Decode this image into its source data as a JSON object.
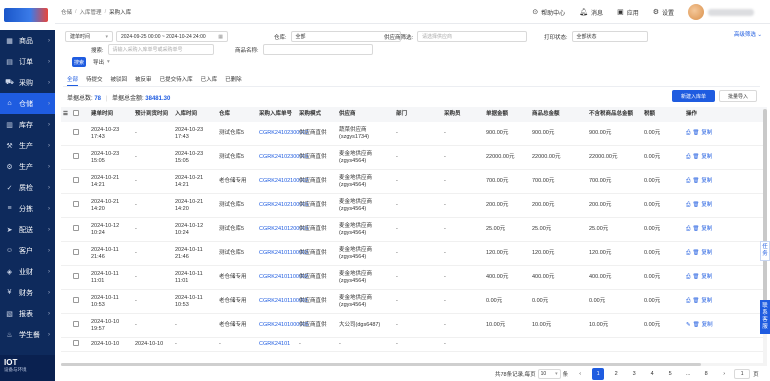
{
  "sidebar": {
    "items": [
      {
        "label": "商品",
        "icon": "grid-icon"
      },
      {
        "label": "订单",
        "icon": "order-icon"
      },
      {
        "label": "采购",
        "icon": "cart-icon"
      },
      {
        "label": "仓储",
        "icon": "warehouse-icon",
        "active": true
      },
      {
        "label": "库存",
        "icon": "stock-icon"
      },
      {
        "label": "生产",
        "icon": "production-icon"
      },
      {
        "label": "生产",
        "icon": "factory-icon"
      },
      {
        "label": "质检",
        "icon": "quality-icon"
      },
      {
        "label": "分拣",
        "icon": "sort-icon"
      },
      {
        "label": "配送",
        "icon": "delivery-icon"
      },
      {
        "label": "客户",
        "icon": "customer-icon"
      },
      {
        "label": "业财",
        "icon": "finance-icon"
      },
      {
        "label": "财务",
        "icon": "money-icon"
      },
      {
        "label": "报表",
        "icon": "report-icon"
      },
      {
        "label": "学生餐",
        "icon": "meal-icon"
      }
    ],
    "footer_title": "IOT",
    "footer_sub": "设备与环境"
  },
  "breadcrumb": [
    "仓储",
    "入库管理",
    "采购入库"
  ],
  "top": {
    "help": "帮助中心",
    "messages": "消息",
    "apps": "应用",
    "settings": "设置"
  },
  "filters": {
    "date_type": "建单时间",
    "date_range": "2024-09-25 00:00 ~ 2024-10-24 24:00",
    "warehouse_label": "仓库:",
    "warehouse_value": "全部",
    "supplier_label": "供应商筛选:",
    "supplier_placeholder": "请选择供应商",
    "print_label": "打印状态:",
    "print_value": "全部状态",
    "advanced": "高级筛选",
    "search_label": "搜索:",
    "search_placeholder": "请输入采购入库单号或采购单号",
    "product_label": "商品名称:",
    "search_button": "搜索",
    "export_button": "导出"
  },
  "tabs": [
    "全部",
    "待提交",
    "被驳回",
    "被反审",
    "已提交待入库",
    "已入库",
    "已删除"
  ],
  "summary": {
    "count_label": "单据总数:",
    "count": "78",
    "amount_label": "单据总金额:",
    "amount": "38481.30"
  },
  "actions": {
    "new": "新建入库单",
    "batch": "批量导入"
  },
  "table": {
    "headers": [
      "建单时间",
      "预计到货时间",
      "入库时间",
      "仓库",
      "采购入库单号",
      "采购模式",
      "供应商",
      "部门",
      "采购员",
      "单据金额",
      "商品总金额",
      "不含税商品总金额",
      "税额",
      "操作"
    ],
    "rows": [
      [
        "2024-10-23 17:43",
        "-",
        "2024-10-23 17:43",
        "测试仓库5",
        "CGRK24102300002",
        "供应商直供",
        "蔬菜供应商(szgys1734)",
        "-",
        "-",
        "900.00元",
        "900.00元",
        "900.00元",
        "0.00元",
        "print-icon",
        "复制"
      ],
      [
        "2024-10-23 15:05",
        "-",
        "2024-10-23 15:05",
        "测试仓库5",
        "CGRK24102300001",
        "供应商直供",
        "麦金地供应商(zgys4564)",
        "-",
        "-",
        "22000.00元",
        "22000.00元",
        "22000.00元",
        "0.00元",
        "print-icon",
        "复制"
      ],
      [
        "2024-10-21 14:21",
        "-",
        "2024-10-21 14:21",
        "老仓储专用",
        "CGRK24102100002",
        "供应商直供",
        "麦金地供应商(zgys4564)",
        "-",
        "-",
        "700.00元",
        "700.00元",
        "700.00元",
        "0.00元",
        "print-icon",
        "复制"
      ],
      [
        "2024-10-21 14:20",
        "-",
        "2024-10-21 14:20",
        "测试仓库5",
        "CGRK24102100001",
        "供应商直供",
        "麦金地供应商(zgys4564)",
        "-",
        "-",
        "200.00元",
        "200.00元",
        "200.00元",
        "0.00元",
        "print-icon",
        "复制"
      ],
      [
        "2024-10-12 10:24",
        "-",
        "2024-10-12 10:24",
        "测试仓库5",
        "CGRK24101200001",
        "供应商直供",
        "麦金地供应商(zgys4564)",
        "-",
        "-",
        "25.00元",
        "25.00元",
        "25.00元",
        "0.00元",
        "print-icon",
        "复制"
      ],
      [
        "2024-10-11 21:46",
        "-",
        "2024-10-11 21:46",
        "测试仓库5",
        "CGRK24101100003",
        "供应商直供",
        "麦金地供应商(zgys4564)",
        "-",
        "-",
        "120.00元",
        "120.00元",
        "120.00元",
        "0.00元",
        "print-icon",
        "复制"
      ],
      [
        "2024-10-11 11:01",
        "-",
        "2024-10-11 11:01",
        "老仓储专用",
        "CGRK24101100002",
        "供应商直供",
        "麦金地供应商(zgys4564)",
        "-",
        "-",
        "400.00元",
        "400.00元",
        "400.00元",
        "0.00元",
        "print-icon",
        "复制"
      ],
      [
        "2024-10-11 10:53",
        "-",
        "2024-10-11 10:53",
        "老仓储专用",
        "CGRK24101100001",
        "供应商直供",
        "麦金地供应商(zgys4564)",
        "-",
        "-",
        "0.00元",
        "0.00元",
        "0.00元",
        "0.00元",
        "print-icon",
        "复制"
      ],
      [
        "2024-10-10 19:57",
        "-",
        "-",
        "老仓储专用",
        "CGRK24101000005",
        "供应商直供",
        "大公司(dgs6487)",
        "-",
        "-",
        "10.00元",
        "10.00元",
        "10.00元",
        "0.00元",
        "edit-icon",
        "复制"
      ],
      [
        "2024-10-10",
        "2024-10-10",
        "-",
        "-",
        "CGRK24101",
        "-",
        "-",
        "-",
        "-",
        "",
        "",
        "",
        "",
        "",
        ""
      ]
    ]
  },
  "pagination": {
    "total": "共78条记录,每页",
    "page_size": "10",
    "unit": "条",
    "pages": [
      "1",
      "2",
      "3",
      "4",
      "5",
      "...",
      "8"
    ],
    "current": "1",
    "jump_value": "1",
    "jump_unit": "页"
  },
  "side_tabs": [
    "任务",
    "联系客服"
  ]
}
